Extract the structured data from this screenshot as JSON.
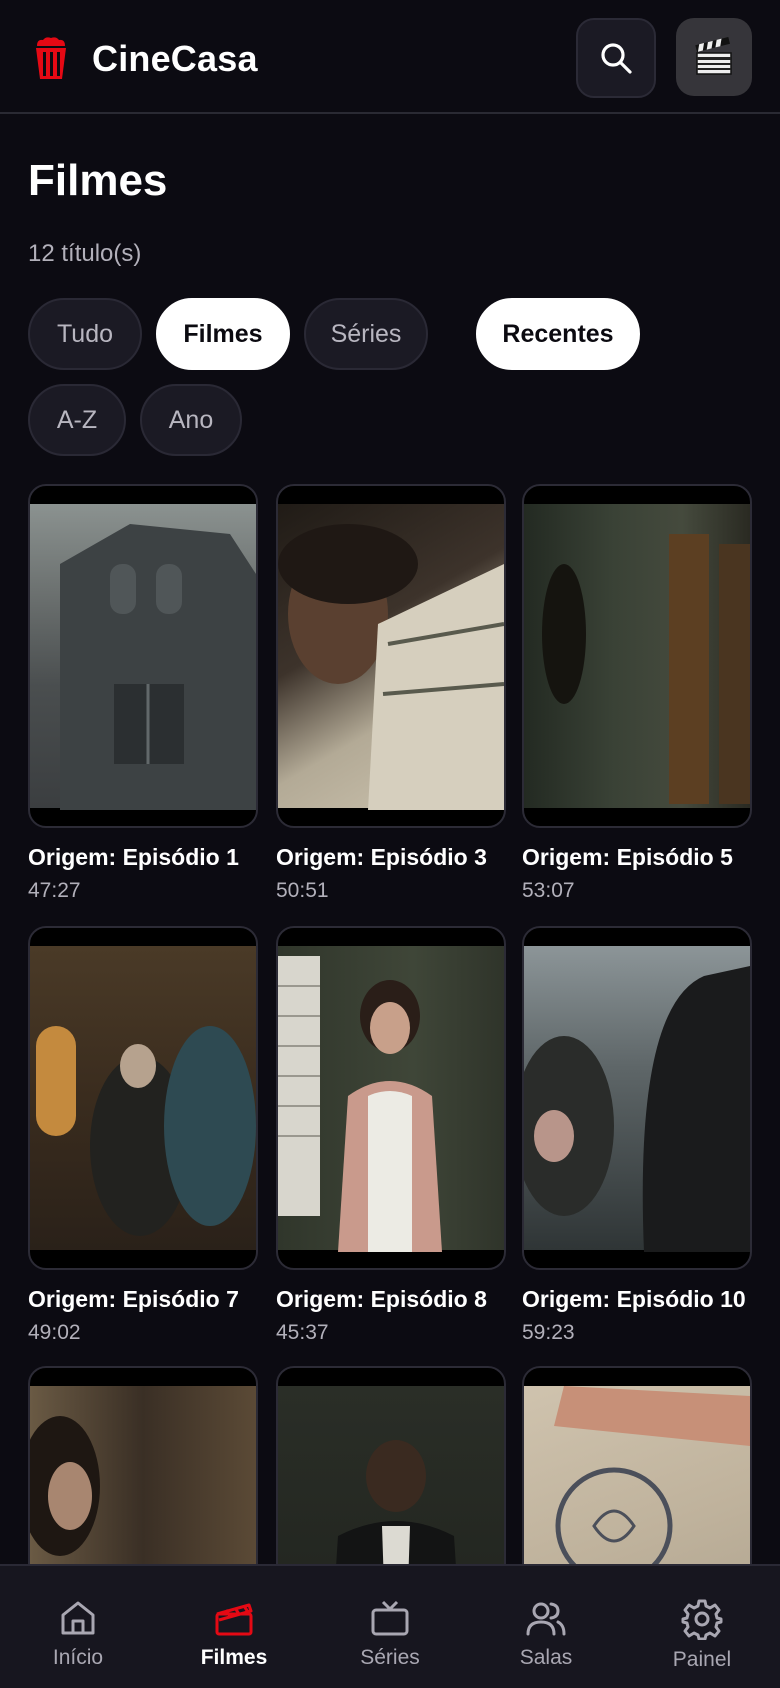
{
  "app": {
    "name": "CineCasa"
  },
  "colors": {
    "accent": "#e50914",
    "background": "#0c0b12",
    "surface": "#1b1a24"
  },
  "header": {
    "logo_icon": "popcorn-icon",
    "search_icon": "search-icon",
    "profile_icon": "clapperboard-icon"
  },
  "page": {
    "title": "Filmes",
    "count": "12 título(s)"
  },
  "filters": [
    {
      "label": "Tudo",
      "active": false
    },
    {
      "label": "Filmes",
      "active": true
    },
    {
      "label": "Séries",
      "active": false
    }
  ],
  "sort": [
    {
      "label": "Recentes",
      "active": true
    },
    {
      "label": "A-Z",
      "active": false
    },
    {
      "label": "Ano",
      "active": false
    }
  ],
  "items": [
    {
      "title": "Origem: Episódio 1",
      "duration": "47:27"
    },
    {
      "title": "Origem: Episódio 3",
      "duration": "50:51"
    },
    {
      "title": "Origem: Episódio 5",
      "duration": "53:07"
    },
    {
      "title": "Origem: Episódio 7",
      "duration": "49:02"
    },
    {
      "title": "Origem: Episódio 8",
      "duration": "45:37"
    },
    {
      "title": "Origem: Episódio 10",
      "duration": "59:23"
    },
    {
      "title": "",
      "duration": ""
    },
    {
      "title": "",
      "duration": ""
    },
    {
      "title": "",
      "duration": ""
    }
  ],
  "nav": [
    {
      "label": "Início",
      "icon": "home-icon",
      "active": false
    },
    {
      "label": "Filmes",
      "icon": "clapperboard-icon",
      "active": true
    },
    {
      "label": "Séries",
      "icon": "tv-icon",
      "active": false
    },
    {
      "label": "Salas",
      "icon": "users-icon",
      "active": false
    },
    {
      "label": "Painel",
      "icon": "gear-icon",
      "active": false
    }
  ]
}
